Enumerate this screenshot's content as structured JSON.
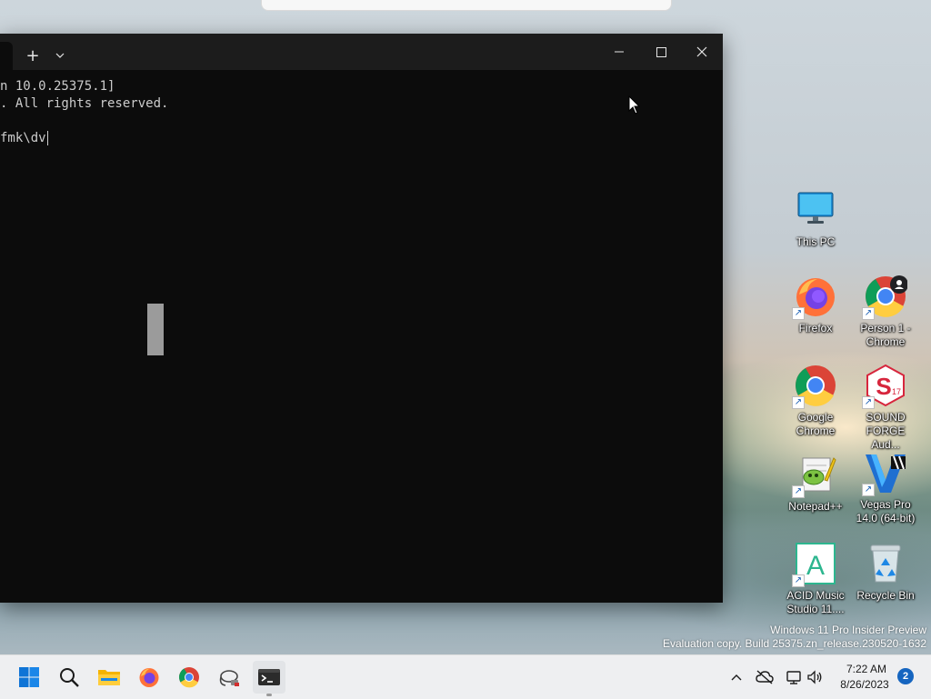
{
  "terminal": {
    "new_tab": "+",
    "dropdown": "⌄",
    "minimize": "—",
    "close": "✕",
    "lines": [
      "n 10.0.25375.1]",
      ". All rights reserved.",
      "fmk\\dv"
    ]
  },
  "desktop": {
    "icons": [
      {
        "label": "This PC"
      },
      {
        "label": "Firefox"
      },
      {
        "label": "Person 1 - Chrome"
      },
      {
        "label": "Google Chrome"
      },
      {
        "label": "SOUND FORGE Aud..."
      },
      {
        "label": "Notepad++"
      },
      {
        "label": "Vegas Pro 14.0 (64-bit)"
      },
      {
        "label": "ACID Music Studio 11...."
      },
      {
        "label": "Recycle Bin"
      }
    ],
    "sound_forge_version": "17",
    "acid_letter": "A",
    "watermark_line1": "Windows 11 Pro Insider Preview",
    "watermark_line2": "Evaluation copy. Build 25375.zn_release.230520-1632"
  },
  "taskbar": {
    "apps": [
      "start",
      "search",
      "file-explorer",
      "firefox",
      "chrome",
      "network-tool",
      "terminal"
    ],
    "time": "7:22 AM",
    "date": "8/26/2023",
    "notifications": "2"
  },
  "colors": {
    "terminal_bg": "#0c0c0c",
    "titlebar_bg": "#1c1c1c",
    "taskbar_bg": "#eeeff1",
    "accent": "#1565c0"
  }
}
